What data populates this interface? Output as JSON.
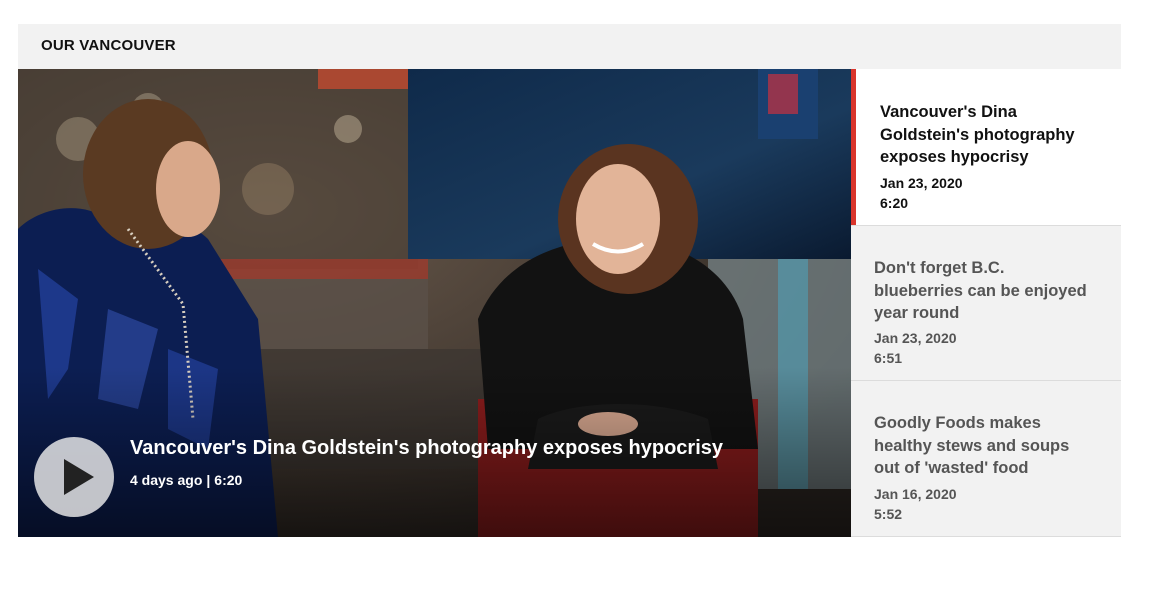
{
  "section": {
    "title": "OUR VANCOUVER"
  },
  "featured": {
    "title": "Vancouver's Dina Goldstein's photography exposes hypocrisy",
    "age": "4 days ago",
    "separator": "|",
    "duration": "6:20",
    "play_icon": "play-icon"
  },
  "playlist": [
    {
      "title_lines": [
        "Vancouver's Dina",
        "Goldstein's photography",
        "exposes hypocrisy"
      ],
      "date": "Jan 23, 2020",
      "duration": "6:20",
      "active": true
    },
    {
      "title_lines": [
        "Don't forget B.C.",
        "blueberries can be enjoyed",
        "year round"
      ],
      "date": "Jan 23, 2020",
      "duration": "6:51",
      "active": false
    },
    {
      "title_lines": [
        "Goodly Foods makes",
        "healthy stews and soups",
        "out of 'wasted' food"
      ],
      "date": "Jan 16, 2020",
      "duration": "5:52",
      "active": false
    }
  ],
  "colors": {
    "accent": "#d9352c",
    "header_bg": "#f2f2f2",
    "sidebar_bg": "#f2f2f2"
  }
}
